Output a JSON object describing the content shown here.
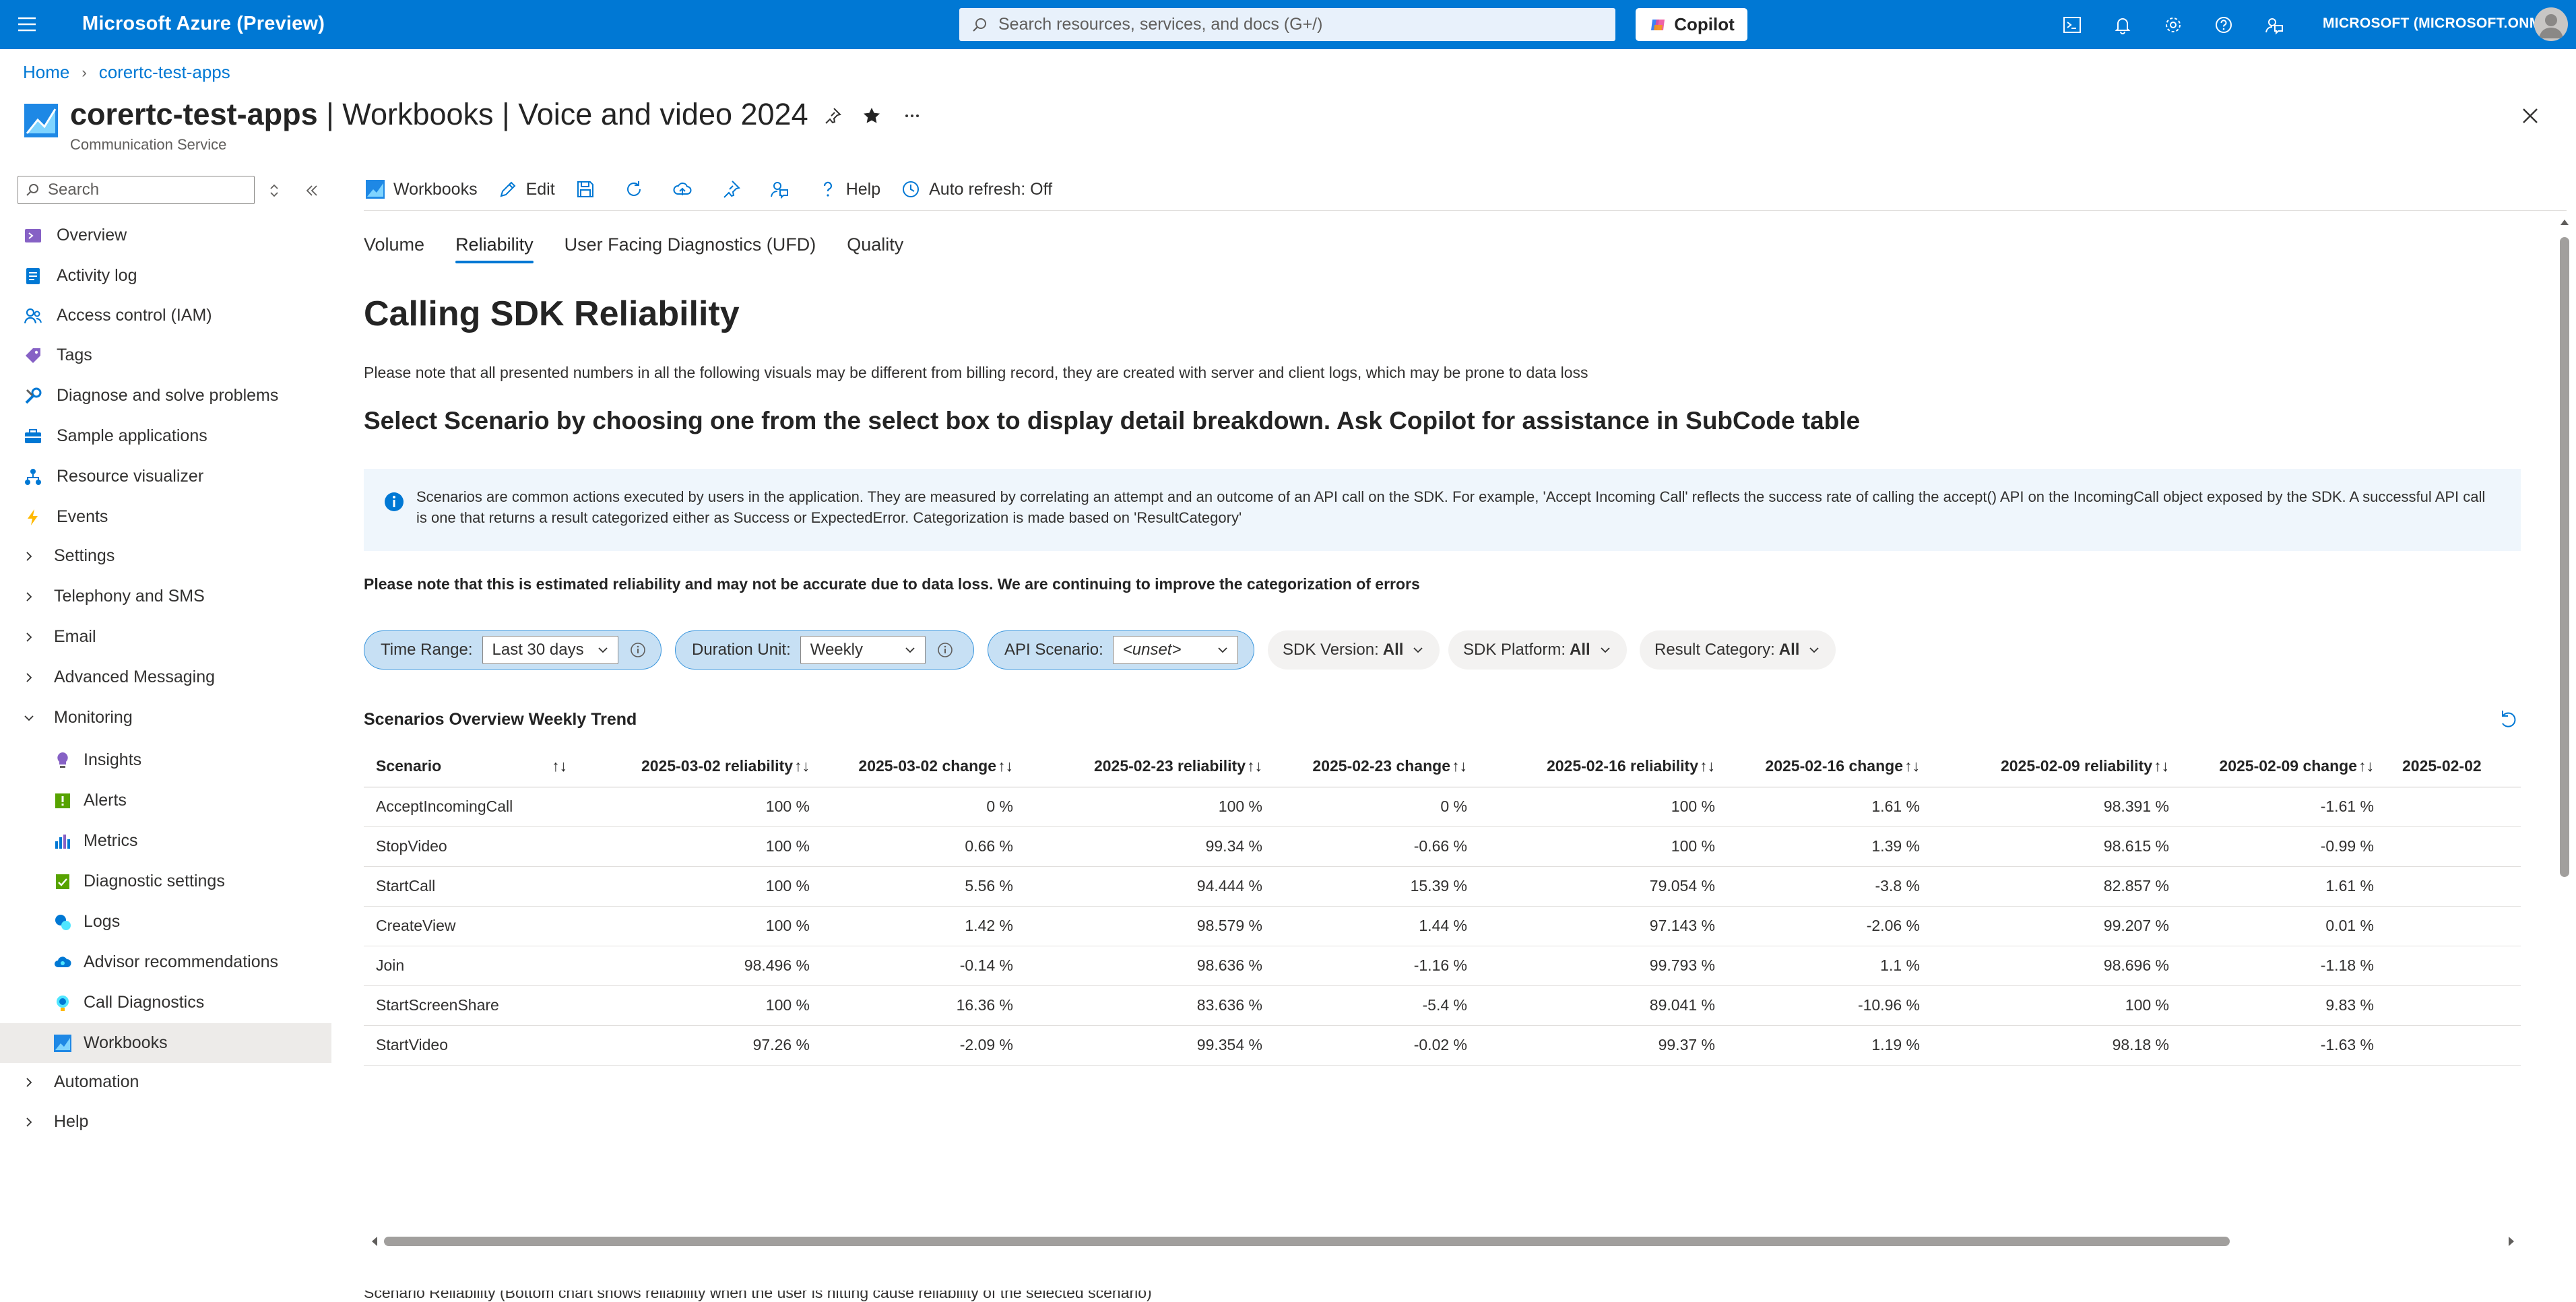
{
  "topbar": {
    "brand": "Microsoft Azure (Preview)",
    "search_placeholder": "Search resources, services, and docs (G+/)",
    "copilot_label": "Copilot",
    "account": "MICROSOFT (MICROSOFT.ONMI..."
  },
  "breadcrumb": {
    "home": "Home",
    "resource": "corertc-test-apps"
  },
  "header": {
    "title_resource": "corertc-test-apps",
    "title_rest": " | Workbooks | Voice and video 2024",
    "subtitle": "Communication Service"
  },
  "sidebar": {
    "search_placeholder": "Search",
    "items": [
      {
        "label": "Overview"
      },
      {
        "label": "Activity log"
      },
      {
        "label": "Access control (IAM)"
      },
      {
        "label": "Tags"
      },
      {
        "label": "Diagnose and solve problems"
      },
      {
        "label": "Sample applications"
      },
      {
        "label": "Resource visualizer"
      },
      {
        "label": "Events"
      },
      {
        "label": "Settings"
      },
      {
        "label": "Telephony and SMS"
      },
      {
        "label": "Email"
      },
      {
        "label": "Advanced Messaging"
      },
      {
        "label": "Monitoring"
      },
      {
        "label": "Insights"
      },
      {
        "label": "Alerts"
      },
      {
        "label": "Metrics"
      },
      {
        "label": "Diagnostic settings"
      },
      {
        "label": "Logs"
      },
      {
        "label": "Advisor recommendations"
      },
      {
        "label": "Call Diagnostics"
      },
      {
        "label": "Workbooks"
      },
      {
        "label": "Automation"
      },
      {
        "label": "Help"
      }
    ]
  },
  "toolbar": {
    "workbooks": "Workbooks",
    "edit": "Edit",
    "help": "Help",
    "auto_refresh": "Auto refresh: Off"
  },
  "tabs": [
    "Volume",
    "Reliability",
    "User Facing Diagnostics (UFD)",
    "Quality"
  ],
  "content": {
    "heading": "Calling SDK Reliability",
    "note": "Please note that all presented numbers in all the following visuals may be different from billing record, they are created with server and client logs, which may be prone to data loss",
    "subheading": "Select Scenario by choosing one from the select box to display detail breakdown. Ask Copilot for assistance in SubCode table",
    "info": "Scenarios are common actions executed by users in the application. They are measured by correlating an attempt and an outcome of an API call on the SDK. For example, 'Accept Incoming Call' reflects the success rate of calling the accept() API on the IncomingCall object exposed by the SDK. A successful API call is one that returns a result categorized either as Success or ExpectedError. Categorization is made based on 'ResultCategory'",
    "warning": "Please note that this is estimated reliability and may not be accurate due to data loss. We are continuing to improve the categorization of errors",
    "bottom_cut": "Scenario Reliability (Bottom chart shows reliability when the user is hitting cause reliability of the selected scenario)"
  },
  "filters": {
    "time_range_label": "Time Range:",
    "time_range_value": "Last 30 days",
    "duration_label": "Duration Unit:",
    "duration_value": "Weekly",
    "api_label": "API Scenario:",
    "api_value": "<unset>",
    "sdk_version_label": "SDK Version:",
    "sdk_version_value": "All",
    "sdk_platform_label": "SDK Platform:",
    "sdk_platform_value": "All",
    "result_category_label": "Result Category:",
    "result_category_value": "All"
  },
  "grid": {
    "title": "Scenarios Overview Weekly Trend",
    "sort_glyph": "↑↓",
    "columns": [
      "Scenario",
      "2025-03-02 reliability",
      "2025-03-02 change",
      "2025-02-23 reliability",
      "2025-02-23 change",
      "2025-02-16 reliability",
      "2025-02-16 change",
      "2025-02-09 reliability",
      "2025-02-09 change",
      "2025-02-02"
    ],
    "rows": [
      [
        "AcceptIncomingCall",
        "100 %",
        "0 %",
        "100 %",
        "0 %",
        "100 %",
        "1.61 %",
        "98.391 %",
        "-1.61 %",
        ""
      ],
      [
        "StopVideo",
        "100 %",
        "0.66 %",
        "99.34 %",
        "-0.66 %",
        "100 %",
        "1.39 %",
        "98.615 %",
        "-0.99 %",
        ""
      ],
      [
        "StartCall",
        "100 %",
        "5.56 %",
        "94.444 %",
        "15.39 %",
        "79.054 %",
        "-3.8 %",
        "82.857 %",
        "1.61 %",
        ""
      ],
      [
        "CreateView",
        "100 %",
        "1.42 %",
        "98.579 %",
        "1.44 %",
        "97.143 %",
        "-2.06 %",
        "99.207 %",
        "0.01 %",
        ""
      ],
      [
        "Join",
        "98.496 %",
        "-0.14 %",
        "98.636 %",
        "-1.16 %",
        "99.793 %",
        "1.1 %",
        "98.696 %",
        "-1.18 %",
        ""
      ],
      [
        "StartScreenShare",
        "100 %",
        "16.36 %",
        "83.636 %",
        "-5.4 %",
        "89.041 %",
        "-10.96 %",
        "100 %",
        "9.83 %",
        ""
      ],
      [
        "StartVideo",
        "97.26 %",
        "-2.09 %",
        "99.354 %",
        "-0.02 %",
        "99.37 %",
        "1.19 %",
        "98.18 %",
        "-1.63 %",
        ""
      ]
    ]
  },
  "colors": {
    "azure_blue": "#0078d4",
    "filter_pill_bg": "#c7e0f4",
    "info_bg": "#eff6fc",
    "selected_nav_bg": "#edebe9"
  }
}
